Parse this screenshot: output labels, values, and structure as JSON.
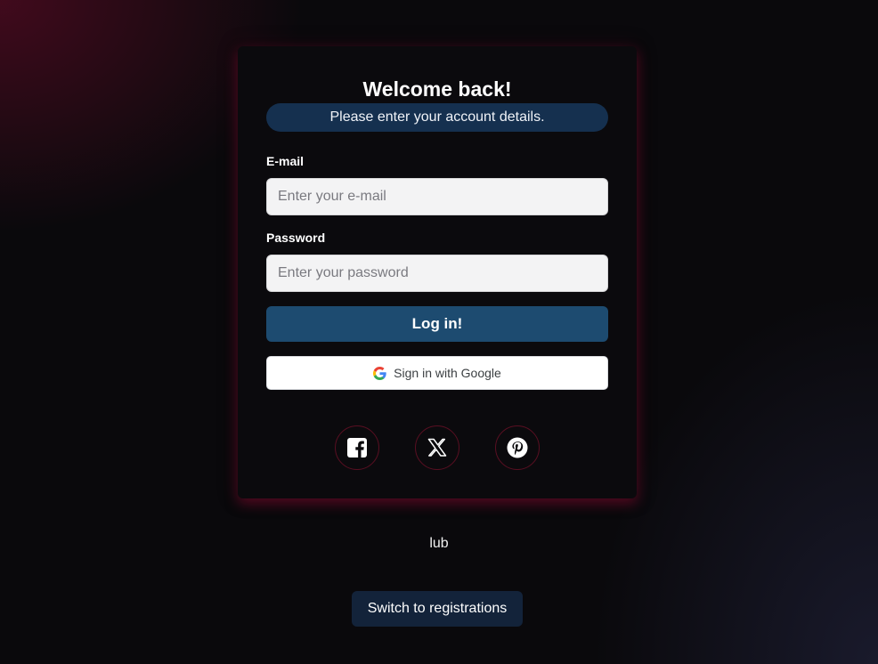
{
  "login": {
    "title": "Welcome back!",
    "subtitle": "Please enter your account details.",
    "email_label": "E-mail",
    "email_placeholder": "Enter your e-mail",
    "email_value": "",
    "password_label": "Password",
    "password_placeholder": "Enter your password",
    "password_value": "",
    "login_button": "Log in!",
    "google_button": "Sign in with Google"
  },
  "social": [
    {
      "name": "facebook-icon"
    },
    {
      "name": "x-twitter-icon"
    },
    {
      "name": "pinterest-icon"
    }
  ],
  "separator_text": "lub",
  "switch_button": "Switch to registrations",
  "colors": {
    "background": "#0a090c",
    "card": "#0b0a0d",
    "primary_button": "#1d4b70",
    "subtitle_pill": "#15304f",
    "accent_glow": "#820a2d",
    "switch_button": "#13233a"
  }
}
